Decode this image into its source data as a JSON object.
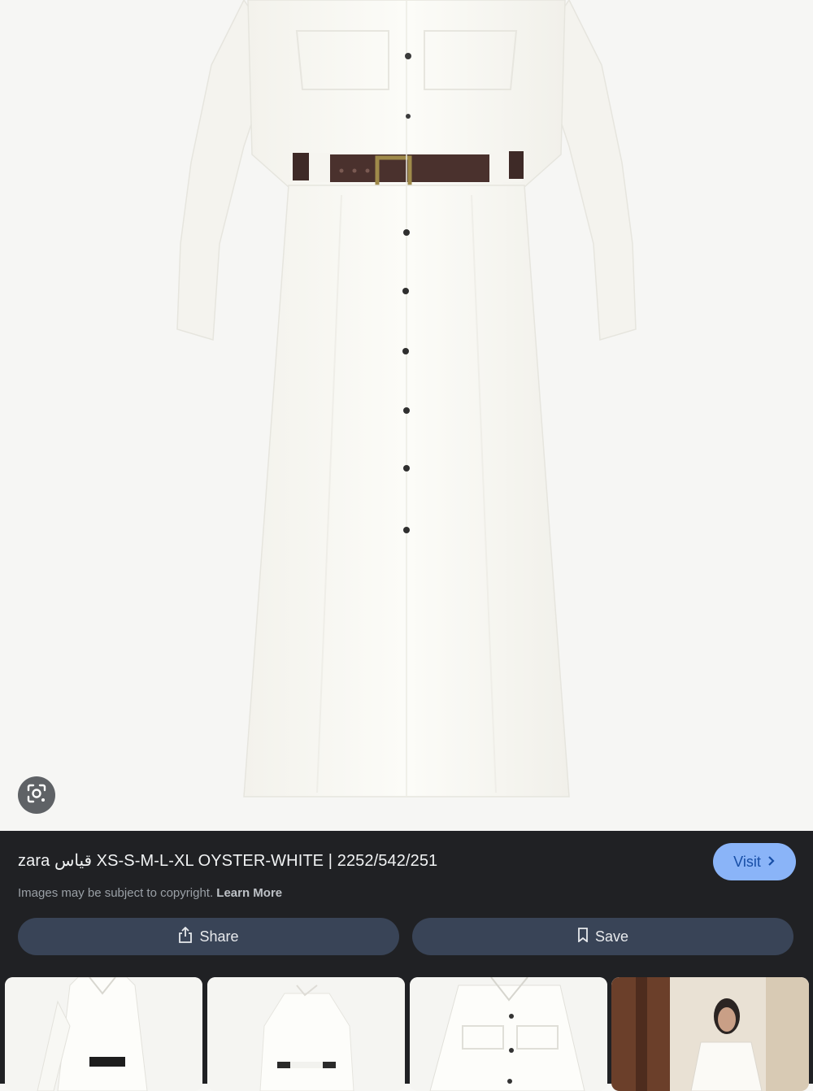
{
  "result": {
    "title_prefix": "zara",
    "title_arabic": "قياس",
    "title_suffix": "XS-S-M-L-XL OYSTER-WHITE | 2252/542/251",
    "copyright_text": "Images may be subject to copyright.",
    "learn_more": "Learn More",
    "visit_label": "Visit",
    "share_label": "Share",
    "save_label": "Save"
  },
  "icons": {
    "lens": "google-lens-icon",
    "visit_chevron": "chevron-right-icon",
    "share": "share-icon",
    "save": "bookmark-icon"
  },
  "colors": {
    "panel_bg": "#202124",
    "visit_bg": "#8ab4f8",
    "action_bg": "#394457"
  }
}
